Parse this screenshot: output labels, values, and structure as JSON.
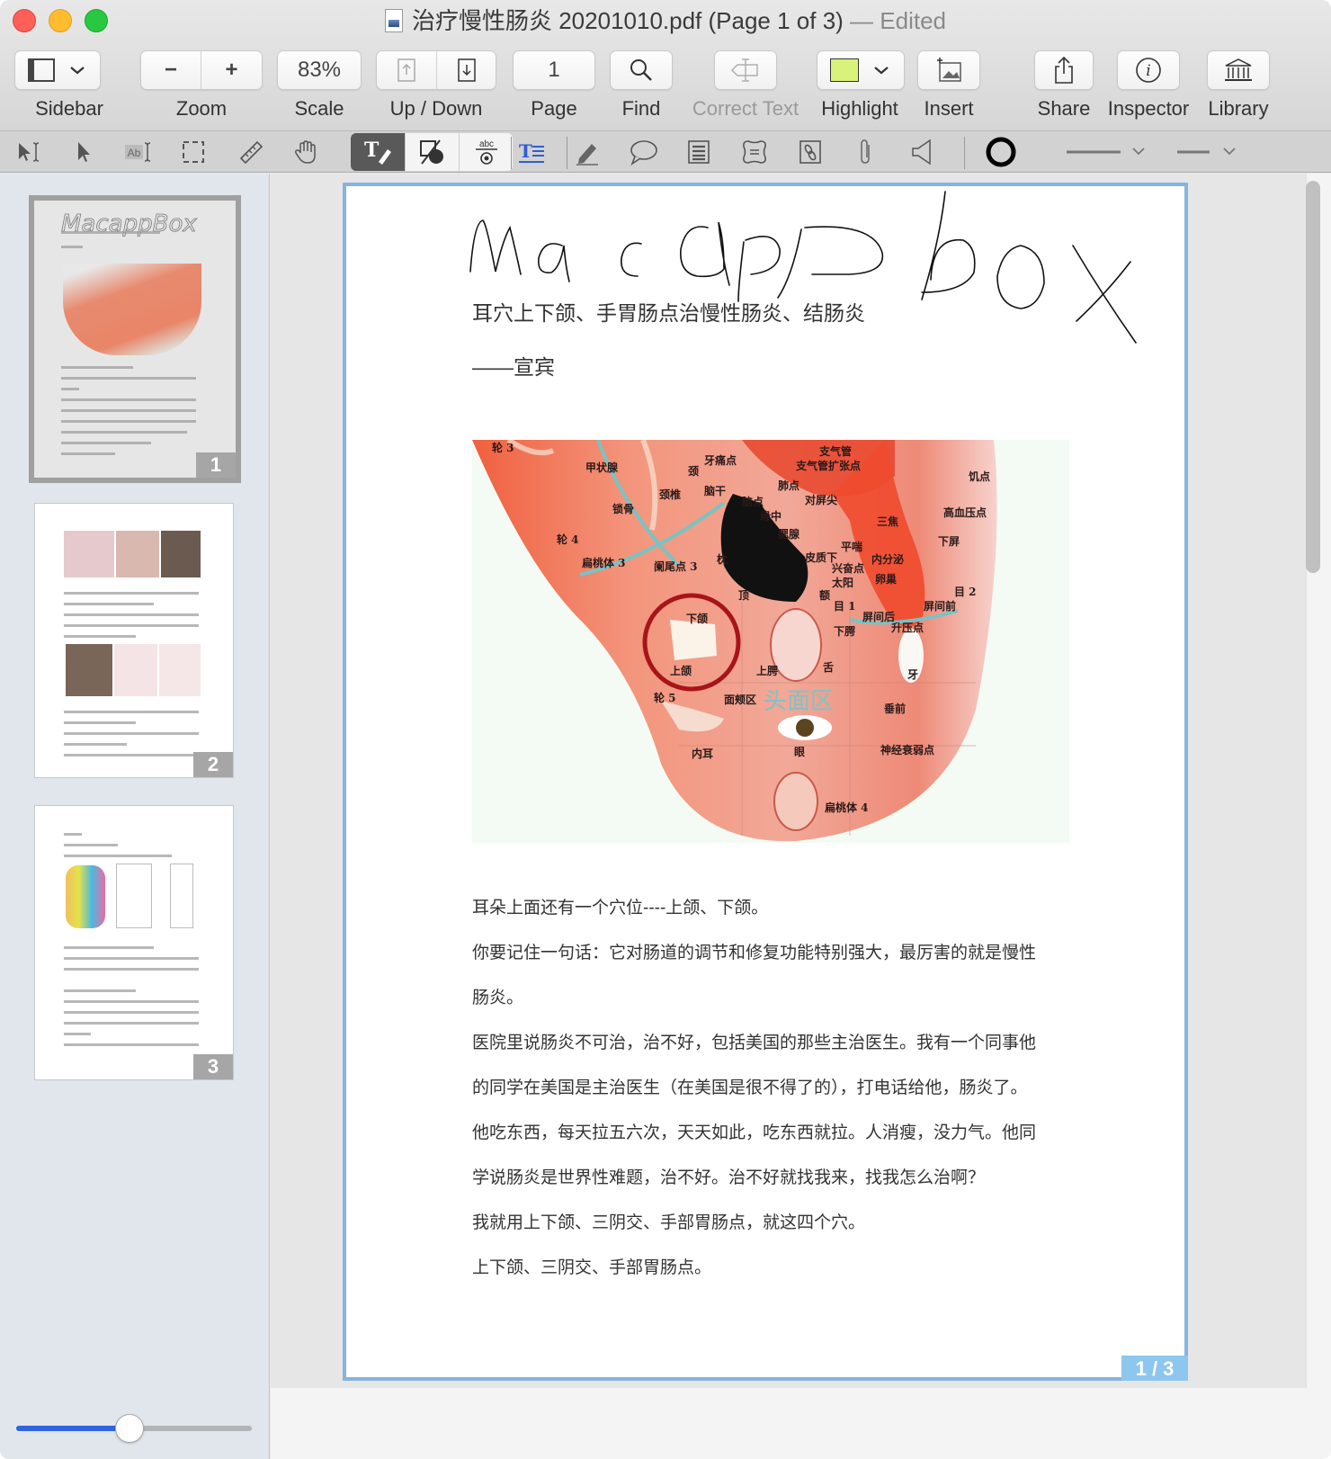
{
  "window": {
    "title_filename": "治疗慢性肠炎 20201010.pdf (Page 1 of 3)",
    "title_status": "— Edited",
    "doc_icon": "pdf-document-icon"
  },
  "toolbar": {
    "sidebar_label": "Sidebar",
    "zoom_label": "Zoom",
    "zoom_out_symbol": "−",
    "zoom_in_symbol": "+",
    "scale_label": "Scale",
    "scale_value": "83%",
    "updown_label": "Up / Down",
    "page_label": "Page",
    "page_value": "1",
    "find_label": "Find",
    "correct_text_label": "Correct Text",
    "highlight_label": "Highlight",
    "highlight_color": "#d9f27a",
    "insert_label": "Insert",
    "share_label": "Share",
    "inspector_label": "Inspector",
    "library_label": "Library"
  },
  "annotation_tools": [
    {
      "name": "text-select-tool",
      "glyph": "⟟"
    },
    {
      "name": "pointer-tool",
      "glyph": "➤"
    },
    {
      "name": "ocr-text-tool",
      "glyph": "Ab"
    },
    {
      "name": "rect-select-tool",
      "glyph": "⬚"
    },
    {
      "name": "measure-tool",
      "glyph": "📏"
    },
    {
      "name": "hand-tool",
      "glyph": "✋"
    }
  ],
  "markup_modes": [
    {
      "name": "text-markup-mode",
      "glyph": "T✎",
      "active": true
    },
    {
      "name": "shape-markup-mode",
      "glyph": "◪",
      "active": false
    },
    {
      "name": "form-markup-mode",
      "glyph": "abc",
      "active": false
    }
  ],
  "markup_tools": [
    {
      "name": "text-box-tool",
      "glyph": "T☰"
    },
    {
      "name": "pen-tool",
      "glyph": "✎"
    },
    {
      "name": "callout-tool",
      "glyph": "💬"
    },
    {
      "name": "note-tool",
      "glyph": "▤"
    },
    {
      "name": "stamp-tool",
      "glyph": "⌘"
    },
    {
      "name": "link-tool",
      "glyph": "🔗"
    },
    {
      "name": "attachment-tool",
      "glyph": "📎"
    },
    {
      "name": "sound-tool",
      "glyph": "◁"
    }
  ],
  "style_controls": {
    "stroke_color": "#000000",
    "line_width_label": "line-width",
    "line_style_label": "line-style"
  },
  "sidebar": {
    "thumbnails": [
      {
        "page": "1",
        "selected": true
      },
      {
        "page": "2",
        "selected": false
      },
      {
        "page": "3",
        "selected": false
      }
    ],
    "thumbnail_size": 0.48
  },
  "document": {
    "annotation_text": "MacappBox",
    "heading": "耳穴上下颌、手胃肠点治慢性肠炎、结肠炎",
    "author": "——宣宾",
    "diagram": {
      "zone_title": "头面区",
      "labels": [
        "轮 3",
        "甲状腺",
        "牙痛点",
        "颈",
        "颈椎",
        "锁骨",
        "脑干",
        "脑点",
        "缘中",
        "对屏尖",
        "支气管",
        "支气管扩张点",
        "肺点",
        "饥点",
        "高血压点",
        "三焦",
        "下屏",
        "轮 4",
        "扁桃体 3",
        "阑尾点 3",
        "枕",
        "腮腺",
        "平喘",
        "皮质下",
        "兴奋点",
        "内分泌",
        "卵巢",
        "太阳",
        "额",
        "顶",
        "目 1",
        "目 2",
        "屏间后",
        "屏间前",
        "升压点",
        "下颌",
        "上颌",
        "下腭",
        "上腭",
        "舌",
        "牙",
        "轮 5",
        "面颊区",
        "垂前",
        "内耳",
        "眼",
        "神经衰弱点",
        "扁桃体 4"
      ]
    },
    "paragraphs": [
      "耳朵上面还有一个穴位----上颌、下颌。",
      "你要记住一句话：它对肠道的调节和修复功能特别强大，最厉害的就是慢性",
      "肠炎。",
      "医院里说肠炎不可治，治不好，包括美国的那些主治医生。我有一个同事他",
      "的同学在美国是主治医生（在美国是很不得了的），打电话给他，肠炎了。",
      "他吃东西，每天拉五六次，天天如此，吃东西就拉。人消瘦，没力气。他同",
      "学说肠炎是世界性难题，治不好。治不好就找我来，找我怎么治啊？",
      "我就用上下颌、三阴交、手部胃肠点，就这四个穴。",
      "上下颌、三阴交、手部胃肠点。"
    ],
    "page_indicator": "1 / 3"
  }
}
